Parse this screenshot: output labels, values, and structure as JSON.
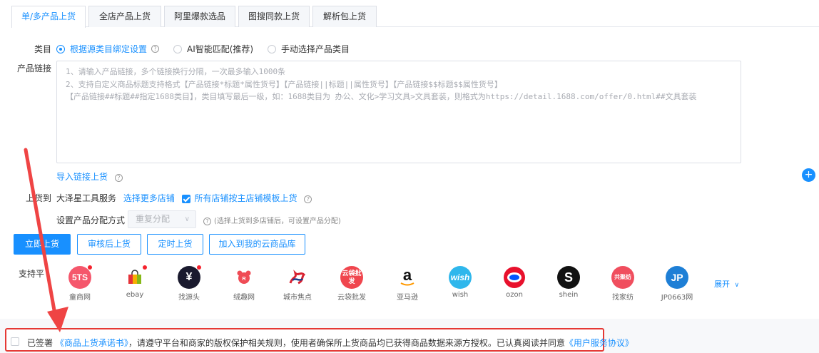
{
  "tabs": [
    "单/多产品上货",
    "全店产品上货",
    "阿里爆款选品",
    "图搜同款上货",
    "解析包上货"
  ],
  "category": {
    "label": "类目",
    "options": [
      "根据源类目绑定设置",
      "AI智能匹配(推荐)",
      "手动选择产品类目"
    ],
    "selected": "根据源类目绑定设置"
  },
  "product_link": {
    "label": "产品链接",
    "placeholder_lines": [
      "1、请输入产品链接，多个链接换行分隔，一次最多输入1000条",
      "2、支持自定义商品标题支持格式【产品链接*标题*属性货号】【产品链接||标题||属性货号】【产品链接$$标题$$属性货号】",
      "【产品链接##标题##指定1688类目】，类目填写最后一级，如：1688类目为 办公、文化>学习文具>文具套装，则格式为https://detail.1688.com/offer/0.html##文具套装"
    ],
    "import_link": "导入链接上货"
  },
  "upload_to": {
    "label": "上货到",
    "store": "大泽星工具服务",
    "select_more": "选择更多店铺",
    "template_checkbox": "所有店铺按主店铺模板上货",
    "template_checked": true
  },
  "distribution": {
    "label": "设置产品分配方式",
    "select_value": "重复分配",
    "hint": "(选择上货到多店铺后，可设置产品分配)"
  },
  "buttons": {
    "upload_now": "立即上货",
    "review_upload": "审核后上货",
    "scheduled_upload": "定时上货",
    "add_cloud": "加入到我的云商品库"
  },
  "platforms": {
    "label": "支持平",
    "items": [
      {
        "name": "童商网",
        "logo": "5TS",
        "color": "#f5576c",
        "dot": true
      },
      {
        "name": "ebay",
        "logo": "",
        "color": "#ffffff",
        "dot": true
      },
      {
        "name": "找源头",
        "logo": "¥",
        "color": "#1a1a2e",
        "dot": true
      },
      {
        "name": "绒趣网",
        "logo": "R",
        "color": "#ffffff",
        "dot": false
      },
      {
        "name": "城市焦点",
        "logo": "",
        "color": "#ffffff",
        "dot": false
      },
      {
        "name": "云袋批发",
        "logo": "云袋批发",
        "color": "#f0464e",
        "dot": false
      },
      {
        "name": "亚马逊",
        "logo": "a",
        "color": "#ffffff",
        "dot": false
      },
      {
        "name": "wish",
        "logo": "wish",
        "color": "#2fb7ec",
        "dot": false
      },
      {
        "name": "ozon",
        "logo": "",
        "color": "#ffffff",
        "dot": false
      },
      {
        "name": "shein",
        "logo": "S",
        "color": "#111111",
        "dot": false
      },
      {
        "name": "找家纺",
        "logo": "共聚纺",
        "color": "#f04e5e",
        "dot": false
      },
      {
        "name": "JP0663网",
        "logo": "JP",
        "color": "#1e7fd6",
        "dot": false
      }
    ],
    "expand": "展开"
  },
  "agreement": {
    "prefix": "已签署",
    "promise_link": "《商品上货承诺书》",
    "middle": "，请遵守平台和商家的版权保护相关规则，使用者确保所上货商品均已获得商品数据来源方授权。已认真阅读并同意",
    "service_link": "《用户服务协议》",
    "checked": false
  },
  "colors": {
    "accent": "#1890ff",
    "highlight": "#e53935"
  }
}
